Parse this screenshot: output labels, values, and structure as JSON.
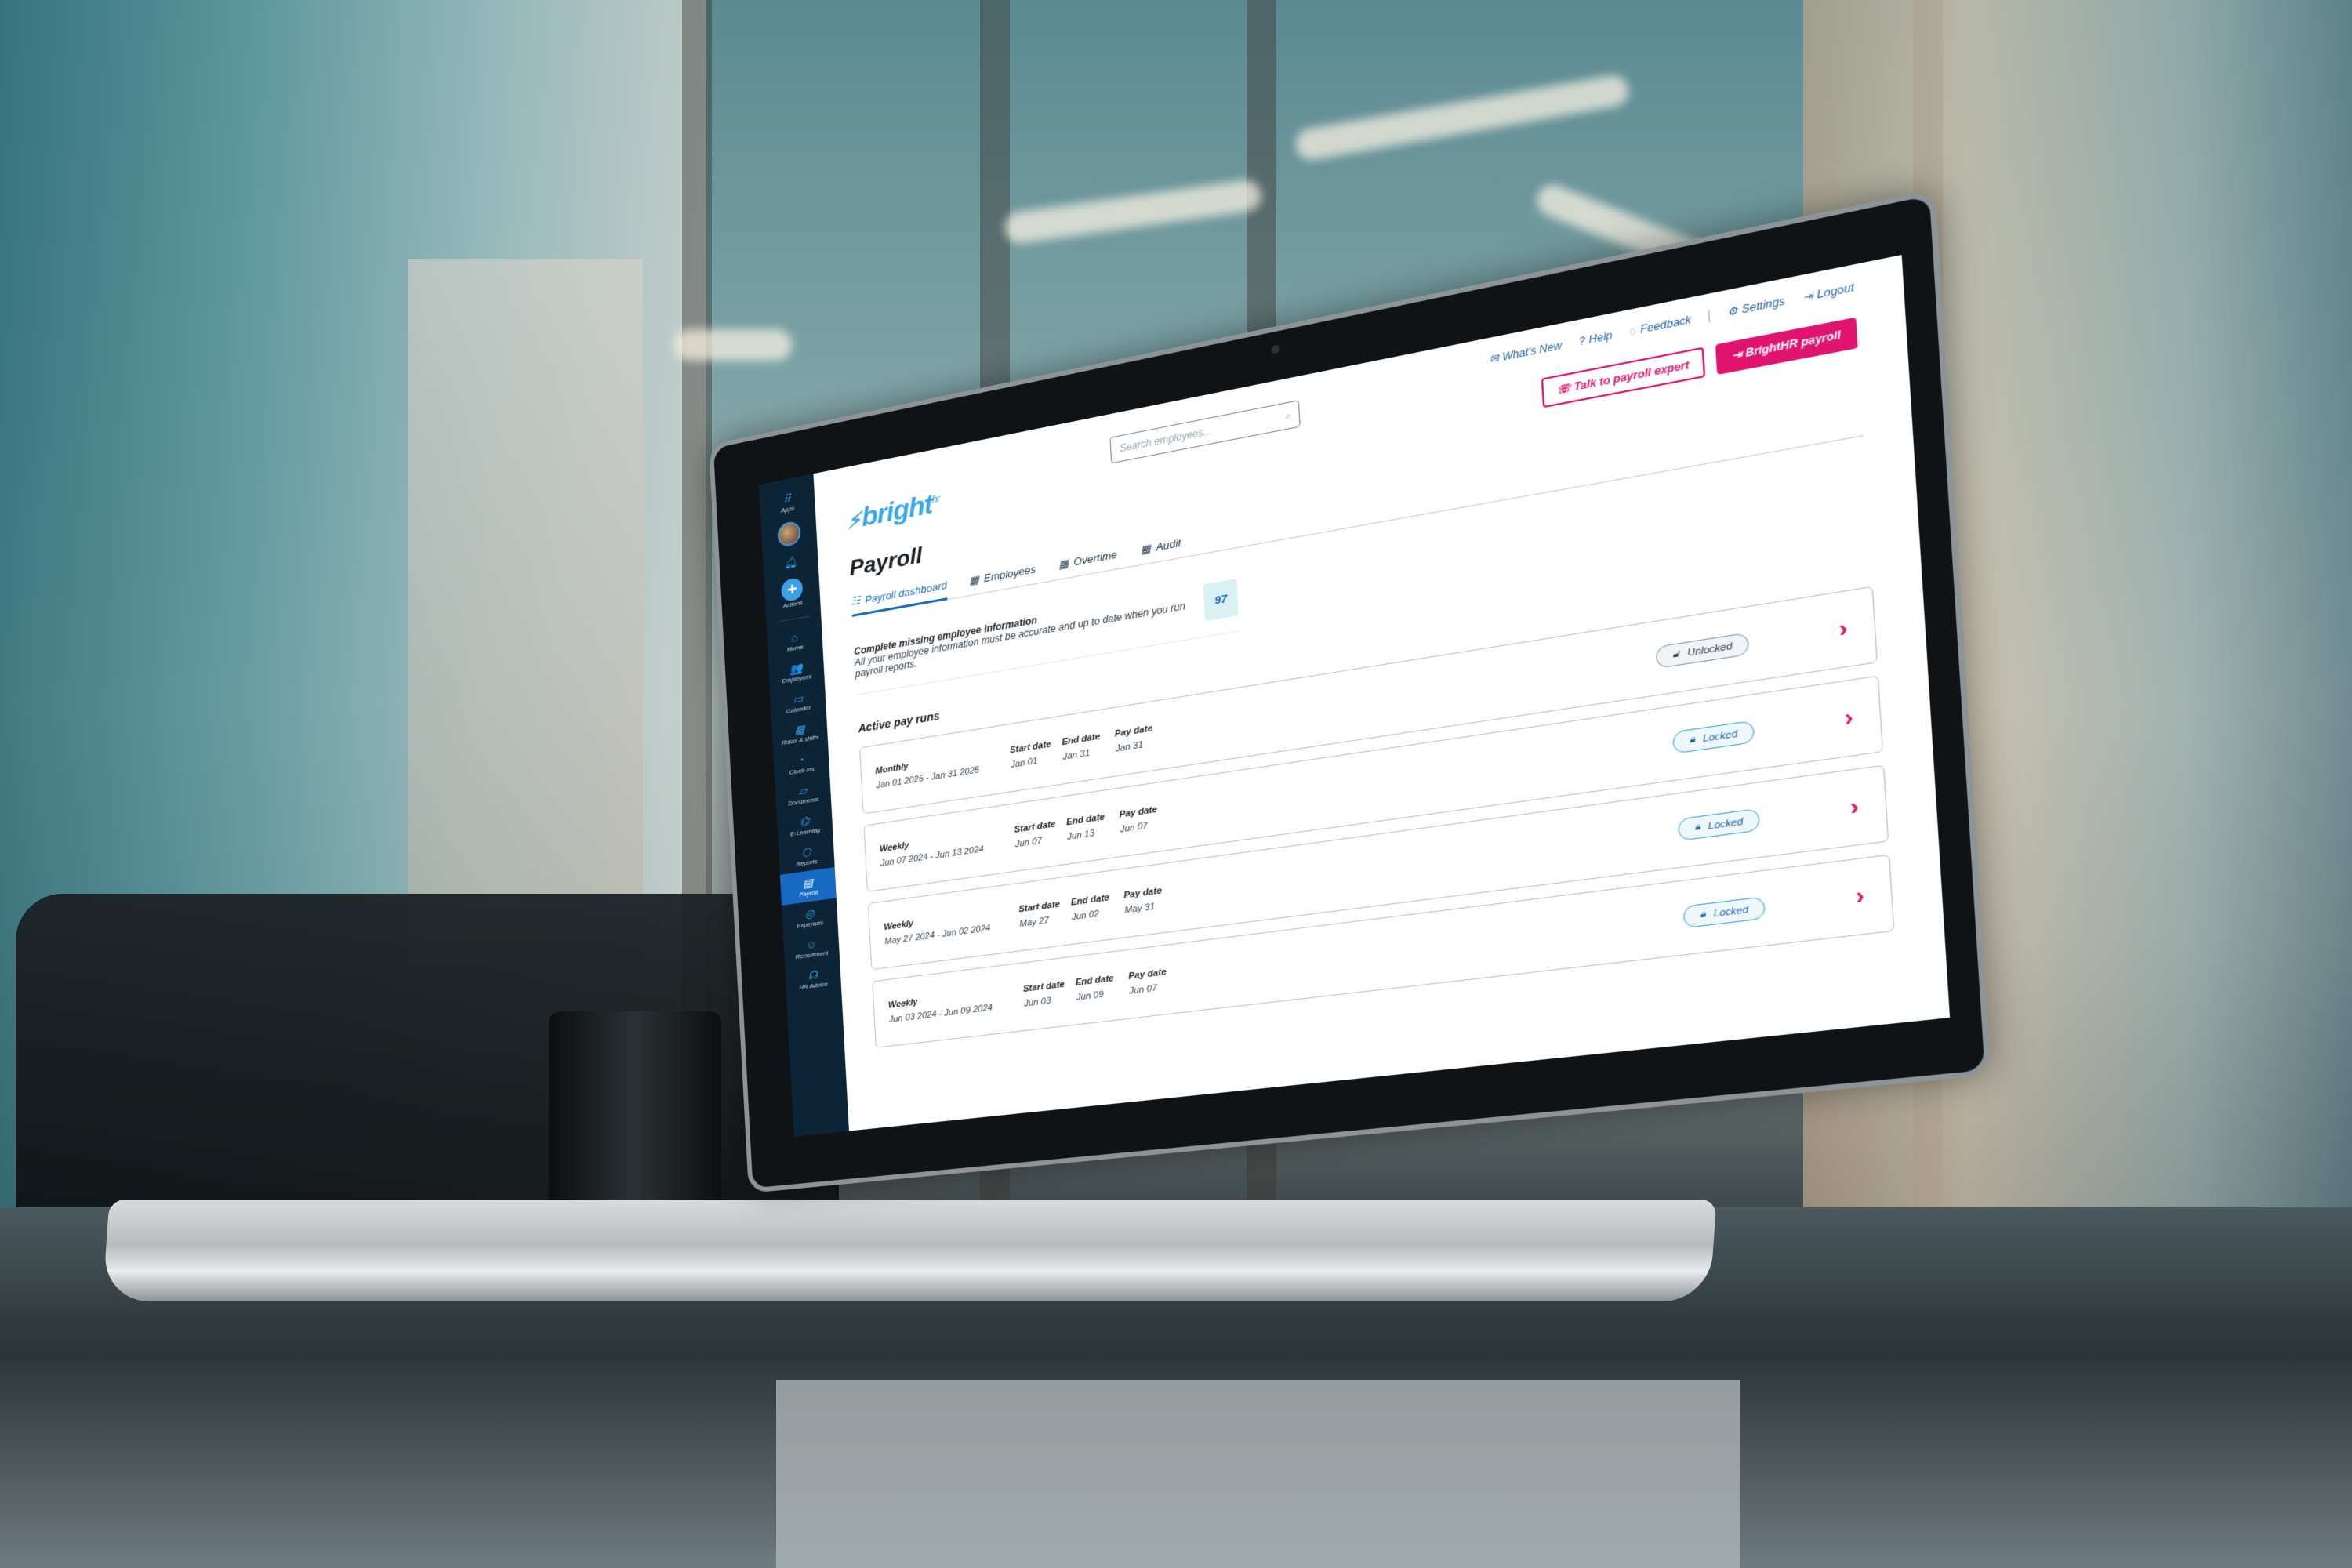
{
  "sidebar": {
    "apps_label": "Apps",
    "actions_label": "Actions",
    "items": [
      {
        "label": "Home",
        "icon": "home-icon",
        "glyph": "⌂"
      },
      {
        "label": "Employees",
        "icon": "employees-icon",
        "glyph": "👥"
      },
      {
        "label": "Calendar",
        "icon": "calendar-icon",
        "glyph": "▭"
      },
      {
        "label": "Rotas & shifts",
        "icon": "rotas-icon",
        "glyph": "▦"
      },
      {
        "label": "Clock-ins",
        "icon": "clock-icon",
        "glyph": "◔"
      },
      {
        "label": "Documents",
        "icon": "documents-icon",
        "glyph": "▱"
      },
      {
        "label": "E-Learning",
        "icon": "elearning-icon",
        "glyph": "⌬"
      },
      {
        "label": "Reports",
        "icon": "reports-icon",
        "glyph": "⬡"
      },
      {
        "label": "Payroll",
        "icon": "payroll-icon",
        "glyph": "▤",
        "active": true
      },
      {
        "label": "Expenses",
        "icon": "expenses-icon",
        "glyph": "◎"
      },
      {
        "label": "Recruitment",
        "icon": "recruitment-icon",
        "glyph": "☺"
      },
      {
        "label": "HR Advice",
        "icon": "headset-icon",
        "glyph": "☊"
      }
    ]
  },
  "header": {
    "logo_text": "bright",
    "logo_sup": "hr",
    "search_placeholder": "Search employees...",
    "links": [
      {
        "label": "What's New",
        "icon": "megaphone-icon",
        "glyph": "✉"
      },
      {
        "label": "Help",
        "icon": "help-icon",
        "glyph": "?"
      },
      {
        "label": "Feedback",
        "icon": "feedback-icon",
        "glyph": "◌"
      },
      {
        "label": "Settings",
        "icon": "gear-icon",
        "glyph": "⚙"
      },
      {
        "label": "Logout",
        "icon": "logout-icon",
        "glyph": "⇥"
      }
    ],
    "talk_button": "Talk to payroll expert",
    "payroll_button": "BrightHR payroll"
  },
  "page": {
    "title": "Payroll",
    "tabs": [
      {
        "label": "Payroll dashboard",
        "active": true
      },
      {
        "label": "Employees"
      },
      {
        "label": "Overtime"
      },
      {
        "label": "Audit"
      }
    ]
  },
  "notice": {
    "title": "Complete missing employee information",
    "text": "All your employee information must be accurate and up to date when you run payroll reports.",
    "count": "97"
  },
  "pay_runs": {
    "title": "Active pay runs",
    "col_start": "Start date",
    "col_end": "End date",
    "col_pay": "Pay date",
    "rows": [
      {
        "type": "Monthly",
        "range": "Jan 01 2025 - Jan 31 2025",
        "start": "Jan 01",
        "end": "Jan 31",
        "pay": "Jan 31",
        "status": "Unlocked"
      },
      {
        "type": "Weekly",
        "range": "Jun 07 2024 - Jun 13 2024",
        "start": "Jun 07",
        "end": "Jun 13",
        "pay": "Jun 07",
        "status": "Locked"
      },
      {
        "type": "Weekly",
        "range": "May 27 2024 - Jun 02 2024",
        "start": "May 27",
        "end": "Jun 02",
        "pay": "May 31",
        "status": "Locked"
      },
      {
        "type": "Weekly",
        "range": "Jun 03 2024 - Jun 09 2024",
        "start": "Jun 03",
        "end": "Jun 09",
        "pay": "Jun 07",
        "status": "Locked"
      }
    ]
  },
  "colors": {
    "brand_pink": "#e0136f",
    "brand_blue": "#1769c2",
    "sidebar_bg": "#0d2436",
    "logo_blue": "#3aa8e8"
  }
}
